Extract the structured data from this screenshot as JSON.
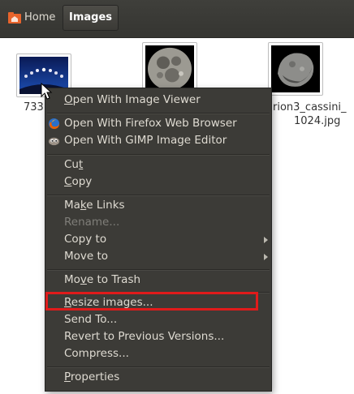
{
  "breadcrumb": {
    "home_label": "Home",
    "current_label": "Images"
  },
  "files": [
    {
      "label": "733",
      "thumb_icon": "moon-phases-thumbnail"
    },
    {
      "label": "",
      "thumb_icon": "full-moon-thumbnail"
    },
    {
      "label_line1": "rion3_cassini_",
      "label_line2": "1024.jpg",
      "thumb_icon": "asteroid-thumbnail"
    }
  ],
  "menu": {
    "open_image_viewer": {
      "pre": "",
      "u": "O",
      "post": "pen With Image Viewer"
    },
    "open_firefox": "Open With Firefox Web Browser",
    "open_gimp": "Open With GIMP Image Editor",
    "cut": {
      "pre": "Cu",
      "u": "t",
      "post": ""
    },
    "copy": {
      "pre": "",
      "u": "C",
      "post": "opy"
    },
    "make_links": {
      "pre": "Ma",
      "u": "k",
      "post": "e Links"
    },
    "rename": "Rename...",
    "copy_to": "Copy to",
    "move_to": "Move to",
    "move_to_trash": {
      "pre": "Mo",
      "u": "v",
      "post": "e to Trash"
    },
    "resize_images": {
      "pre": "",
      "u": "R",
      "post": "esize images..."
    },
    "send_to": "Send To...",
    "revert": "Revert to Previous Versions...",
    "compress": "Compress...",
    "properties": {
      "pre": "",
      "u": "P",
      "post": "roperties"
    }
  },
  "colors": {
    "menu_bg": "#3c3b37",
    "menu_text": "#dfdbd2",
    "disabled_text": "#7f7e79",
    "highlight_outline": "#e01b1b"
  }
}
